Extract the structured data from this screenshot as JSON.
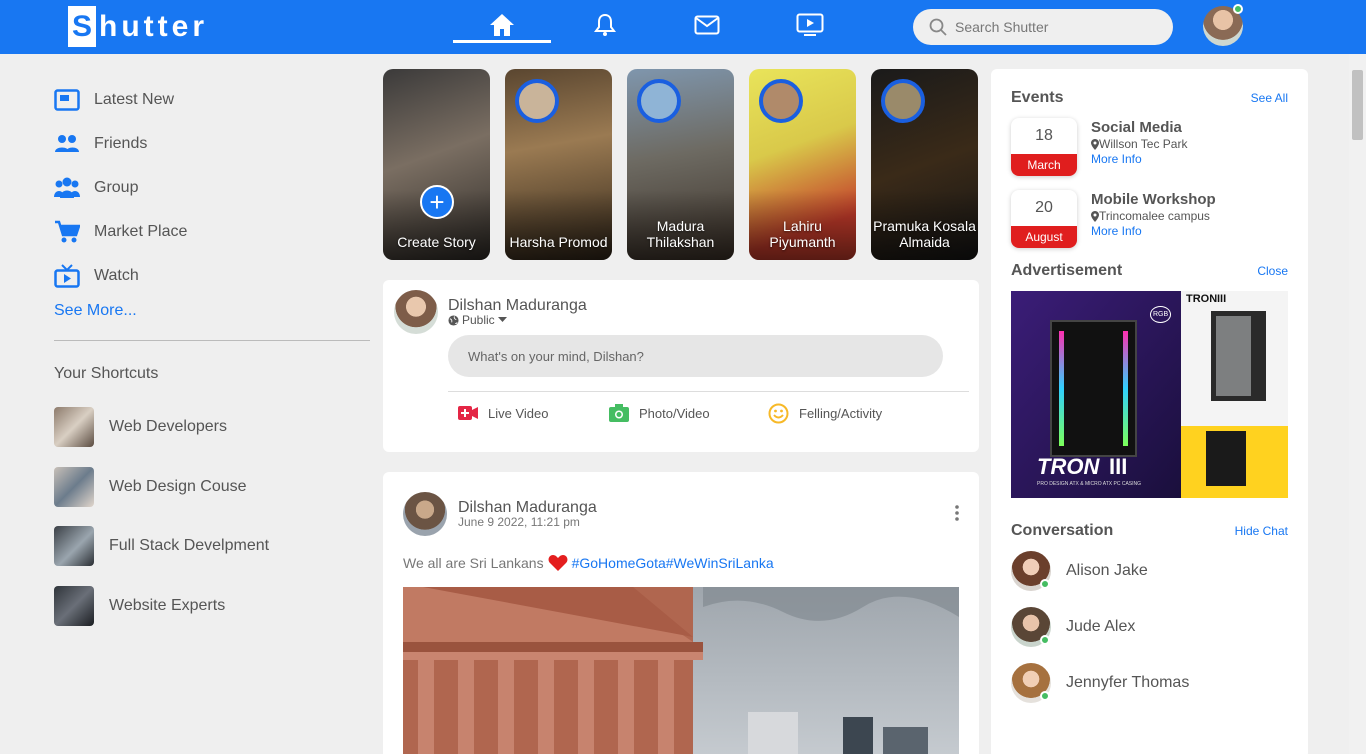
{
  "nav": {
    "logo_first": "S",
    "logo_rest": "hutter",
    "search_placeholder": "Search Shutter",
    "icons": [
      "home-icon",
      "bell-icon",
      "mail-icon",
      "video-icon"
    ],
    "active": "home",
    "accent": "#1877f2"
  },
  "sidebar": {
    "items": [
      {
        "label": "Latest New",
        "icon": "news-icon"
      },
      {
        "label": "Friends",
        "icon": "friends-icon"
      },
      {
        "label": "Group",
        "icon": "group-icon"
      },
      {
        "label": "Market Place",
        "icon": "cart-icon"
      },
      {
        "label": "Watch",
        "icon": "tv-icon"
      }
    ],
    "see_more": "See More...",
    "shortcuts_title": "Your Shortcuts",
    "shortcuts": [
      {
        "label": "Web Developers"
      },
      {
        "label": "Web Design Couse"
      },
      {
        "label": "Full Stack Develpment"
      },
      {
        "label": "Website Experts"
      }
    ]
  },
  "stories": [
    {
      "name": "Create Story"
    },
    {
      "name": "Harsha Promod"
    },
    {
      "name": "Madura Thilakshan"
    },
    {
      "name": "Lahiru Piyumanth"
    },
    {
      "name": "Pramuka Kosala Almaida"
    }
  ],
  "composer": {
    "name": "Dilshan Maduranga",
    "privacy": "Public",
    "placeholder": "What's on your mind, Dilshan?",
    "actions": [
      {
        "label": "Live Video",
        "icon": "live-video-icon",
        "color": "#e42645"
      },
      {
        "label": "Photo/Video",
        "icon": "camera-icon",
        "color": "#45bd62"
      },
      {
        "label": "Felling/Activity",
        "icon": "smile-icon",
        "color": "#f7b928"
      }
    ]
  },
  "post": {
    "author": "Dilshan Maduranga",
    "time": "June 9 2022, 11:21 pm",
    "text": "We all are Sri Lankans",
    "tags": "#GoHomeGota#WeWinSriLanka"
  },
  "events": {
    "title": "Events",
    "see_all": "See All",
    "list": [
      {
        "day": "18",
        "month": "March",
        "title": "Social Media",
        "location": "Willson Tec Park",
        "more": "More Info"
      },
      {
        "day": "20",
        "month": "August",
        "title": "Mobile Workshop",
        "location": "Trincomalee campus",
        "more": "More Info"
      }
    ]
  },
  "advertisement": {
    "title": "Advertisement",
    "close": "Close",
    "brand_main": "TRON",
    "brand_bars": "III",
    "badge": "RGB",
    "tagline": "PRO DESIGN ATX & MICRO ATX PC CASING"
  },
  "conversation": {
    "title": "Conversation",
    "hide": "Hide Chat",
    "people": [
      {
        "name": "Alison Jake"
      },
      {
        "name": "Jude Alex"
      },
      {
        "name": "Jennyfer Thomas"
      }
    ]
  }
}
